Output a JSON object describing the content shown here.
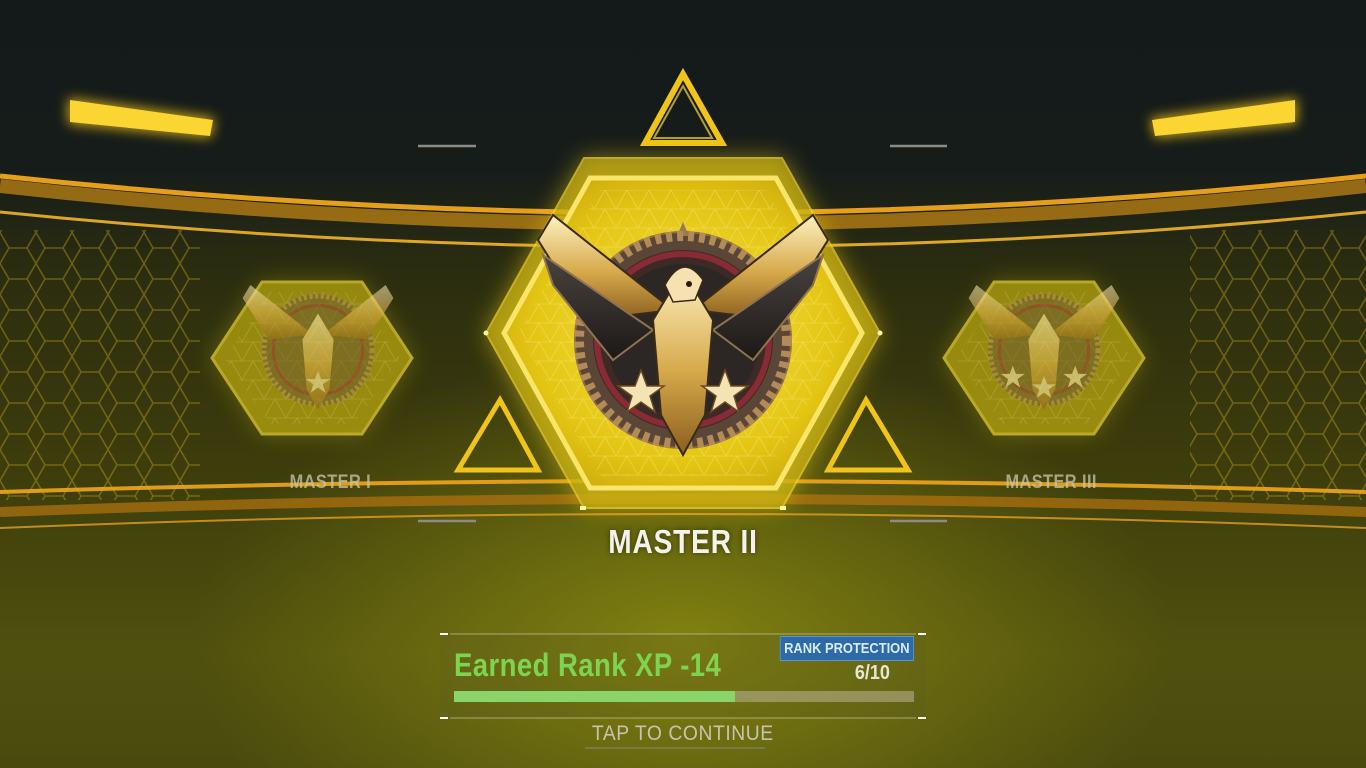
{
  "ranks": {
    "previous": {
      "label": "MASTER I",
      "stars": 1
    },
    "current": {
      "label": "MASTER II",
      "stars": 2
    },
    "next": {
      "label": "MASTER III",
      "stars": 3
    }
  },
  "xp": {
    "label": "Earned Rank XP -14",
    "progress": 0.61
  },
  "rank_protection": {
    "label": "RANK PROTECTION",
    "count": "6/10"
  },
  "continue_prompt": "TAP TO CONTINUE",
  "colors": {
    "accent": "#f2c40c",
    "xp_text": "#7ed34f",
    "badge": "#2f6aa8"
  }
}
